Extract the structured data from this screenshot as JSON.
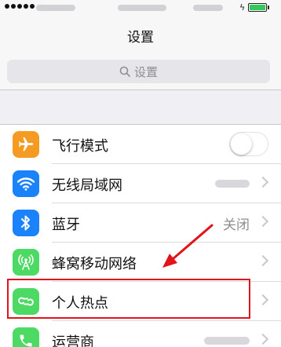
{
  "status_bar": {
    "signal_dots": 5,
    "battery_color": "#34c759"
  },
  "navbar": {
    "title": "设置"
  },
  "search": {
    "placeholder": "设置"
  },
  "settings": {
    "airplane": {
      "label": "飞行模式",
      "toggle_on": false,
      "icon": "airplane-icon",
      "color": "#f59a23"
    },
    "wifi": {
      "label": "无线局域网",
      "icon": "wifi-icon",
      "color": "#1a82fb"
    },
    "bluetooth": {
      "label": "蓝牙",
      "value": "关闭",
      "icon": "bluetooth-icon",
      "color": "#1a82fb"
    },
    "cellular": {
      "label": "蜂窝移动网络",
      "icon": "antenna-icon",
      "color": "#4cd964"
    },
    "hotspot": {
      "label": "个人热点",
      "icon": "hotspot-icon",
      "color": "#4cd964"
    },
    "carrier": {
      "label": "运营商",
      "icon": "phone-icon",
      "color": "#4cd964"
    }
  },
  "annotation": {
    "color": "#e0141b"
  }
}
